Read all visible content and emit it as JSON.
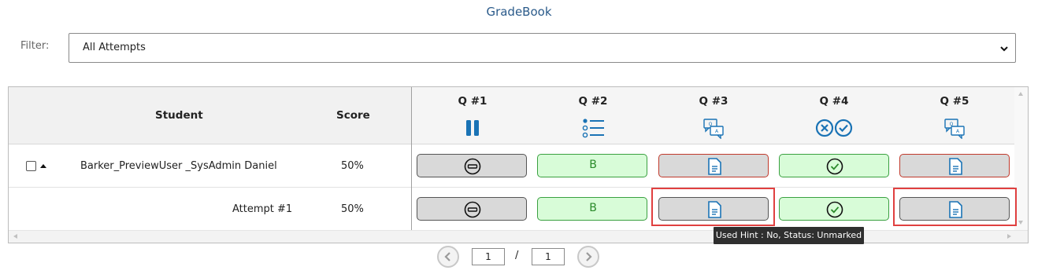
{
  "title": "GradeBook",
  "filter": {
    "label": "Filter:",
    "selected": "All Attempts"
  },
  "table": {
    "headers": {
      "student": "Student",
      "score": "Score"
    },
    "questions": [
      {
        "label": "Q #1",
        "icon": "pause-icon"
      },
      {
        "label": "Q #2",
        "icon": "list-icon"
      },
      {
        "label": "Q #3",
        "icon": "chat-bubbles-icon"
      },
      {
        "label": "Q #4",
        "icon": "cross-check-icon"
      },
      {
        "label": "Q #5",
        "icon": "chat-bubbles-icon"
      }
    ],
    "rows": [
      {
        "student": "Barker_PreviewUser _SysAdmin Daniel",
        "score": "50%",
        "cells": [
          {
            "kind": "grey",
            "icon": "minus-circle-icon"
          },
          {
            "kind": "green",
            "text": "B"
          },
          {
            "kind": "redb",
            "icon": "document-icon"
          },
          {
            "kind": "green",
            "icon": "check-circle-icon"
          },
          {
            "kind": "redb",
            "icon": "document-icon"
          }
        ]
      },
      {
        "student": "Attempt #1",
        "score": "50%",
        "cells": [
          {
            "kind": "grey",
            "icon": "minus-circle-icon"
          },
          {
            "kind": "green",
            "text": "B"
          },
          {
            "kind": "grey",
            "icon": "document-icon"
          },
          {
            "kind": "green",
            "icon": "check-circle-icon"
          },
          {
            "kind": "grey",
            "icon": "document-icon"
          }
        ]
      }
    ]
  },
  "tooltip": "Used Hint : No, Status: Unmarked",
  "pager": {
    "current": "1",
    "separator": "/",
    "total": "1"
  },
  "colors": {
    "accent": "#1a73b5",
    "green": "#2a8a2a",
    "red": "#c0392b"
  }
}
